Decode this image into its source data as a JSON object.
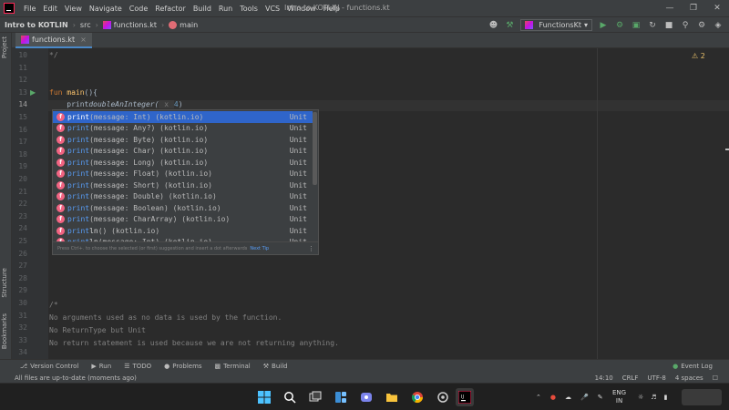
{
  "menubar": {
    "items": [
      "File",
      "Edit",
      "View",
      "Navigate",
      "Code",
      "Refactor",
      "Build",
      "Run",
      "Tools",
      "VCS",
      "Window",
      "Help"
    ],
    "window_title": "Intro to KOTLIN - functions.kt"
  },
  "navbar": {
    "project": "Intro to KOTLIN",
    "folder": "src",
    "file": "functions.kt",
    "function": "main",
    "run_config": "FunctionsKt"
  },
  "left_tabs": {
    "project": "Project",
    "structure": "Structure",
    "bookmarks": "Bookmarks"
  },
  "editor_tab": {
    "label": "functions.kt"
  },
  "editor": {
    "warning_count": "2",
    "line_numbers": [
      "10",
      "11",
      "12",
      "13",
      "14",
      "15",
      "16",
      "17",
      "18",
      "19",
      "20",
      "21",
      "22",
      "23",
      "24",
      "25",
      "26",
      "27",
      "28",
      "29",
      "30",
      "31",
      "32",
      "33",
      "34"
    ],
    "current_line": "14",
    "code": {
      "l10": "*/",
      "l13_kw": "fun ",
      "l13_fn": "main",
      "l13_rest": "(){",
      "l14_typed": "print",
      "l14_call": "doubleAnInteger(",
      "l14_hint": " x ",
      "l14_arg": "4",
      "l14_close": ")",
      "l30": "/*",
      "l31": "No arguments used as no data is used by the function.",
      "l32": "No ReturnType but Unit",
      "l33": "No return statement is used because we are not returning anything."
    }
  },
  "completion": {
    "items": [
      {
        "match": "print",
        "rest": "",
        "sig": "(message: Int) (kotlin.io)",
        "type": "Unit"
      },
      {
        "match": "print",
        "rest": "",
        "sig": "(message: Any?) (kotlin.io)",
        "type": "Unit"
      },
      {
        "match": "print",
        "rest": "",
        "sig": "(message: Byte) (kotlin.io)",
        "type": "Unit"
      },
      {
        "match": "print",
        "rest": "",
        "sig": "(message: Char) (kotlin.io)",
        "type": "Unit"
      },
      {
        "match": "print",
        "rest": "",
        "sig": "(message: Long) (kotlin.io)",
        "type": "Unit"
      },
      {
        "match": "print",
        "rest": "",
        "sig": "(message: Float) (kotlin.io)",
        "type": "Unit"
      },
      {
        "match": "print",
        "rest": "",
        "sig": "(message: Short) (kotlin.io)",
        "type": "Unit"
      },
      {
        "match": "print",
        "rest": "",
        "sig": "(message: Double) (kotlin.io)",
        "type": "Unit"
      },
      {
        "match": "print",
        "rest": "",
        "sig": "(message: Boolean) (kotlin.io)",
        "type": "Unit"
      },
      {
        "match": "print",
        "rest": "",
        "sig": "(message: CharArray) (kotlin.io)",
        "type": "Unit"
      },
      {
        "match": "print",
        "rest": "ln",
        "sig": "() (kotlin.io)",
        "type": "Unit"
      },
      {
        "match": "print",
        "rest": "ln",
        "sig": "(message: Int) (kotlin.io)",
        "type": "Unit"
      }
    ],
    "footer": "Press Ctrl+. to choose the selected (or first) suggestion and insert a dot afterwards",
    "next_tip": "Next Tip"
  },
  "bottom_tools": {
    "version_control": "Version Control",
    "run": "Run",
    "todo": "TODO",
    "problems": "Problems",
    "terminal": "Terminal",
    "build": "Build",
    "event_log": "Event Log"
  },
  "status": {
    "message": "All files are up-to-date (moments ago)",
    "position": "14:10",
    "line_sep": "CRLF",
    "encoding": "UTF-8",
    "indent": "4 spaces"
  },
  "taskbar": {
    "lang": "ENG",
    "region": "IN"
  },
  "colors": {
    "accent": "#2f65ca",
    "run_green": "#59a869",
    "keyword": "#cc7832",
    "function": "#ffc66d"
  }
}
